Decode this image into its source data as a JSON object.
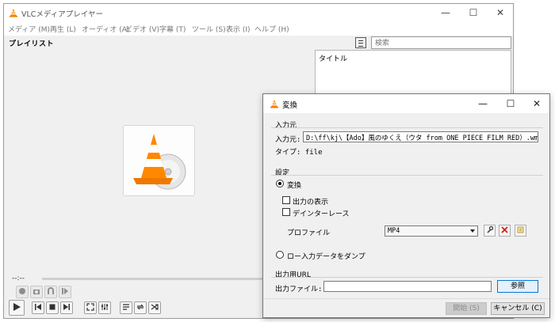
{
  "main_window": {
    "title": "VLCメディアプレイヤー",
    "window_controls": {
      "minimize": "—",
      "maximize": "☐",
      "close": "✕"
    },
    "menu": [
      "メディア (M)",
      "再生 (L)",
      "オーディオ (A)",
      "ビデオ (V)",
      "字幕 (T)",
      "ツール (S)",
      "表示 (I)",
      "ヘルプ (H)"
    ],
    "playlist_title": "プレイリスト",
    "search": {
      "placeholder": "検索"
    },
    "list_column_header": "タイトル",
    "time_display": "--:--",
    "controls": {
      "row1": [
        "record-icon",
        "snapshot-icon",
        "loop-ab-icon",
        "frame-step-icon"
      ],
      "row2": [
        "play-icon",
        "previous-icon",
        "stop-icon",
        "next-icon",
        "fullscreen-icon",
        "extended-settings-icon",
        "playlist-icon",
        "loop-icon",
        "shuffle-icon"
      ]
    },
    "accent": "#ff8800"
  },
  "convert_dialog": {
    "title": "変換",
    "source_section": "入力元",
    "source_label": "入力元:",
    "source_value": "D:\\ff\\kj\\【Ado】風のゆくえ（ウタ from ONE PIECE FILM RED）.wmv",
    "type_line": "タイプ: file",
    "settings_section": "設定",
    "convert_option": "変換",
    "show_output": "出力の表示",
    "deinterlace": "デインターレース",
    "profile_label": "プロファイル",
    "profile_value": "MP4",
    "dump_raw": "ロー入力データをダンプ",
    "destination_section": "出力用URL",
    "output_file_label": "出力ファイル:",
    "output_file_value": "",
    "browse_button": "参照",
    "start_button": "開始 (S)",
    "cancel_button": "キャンセル (C)"
  }
}
